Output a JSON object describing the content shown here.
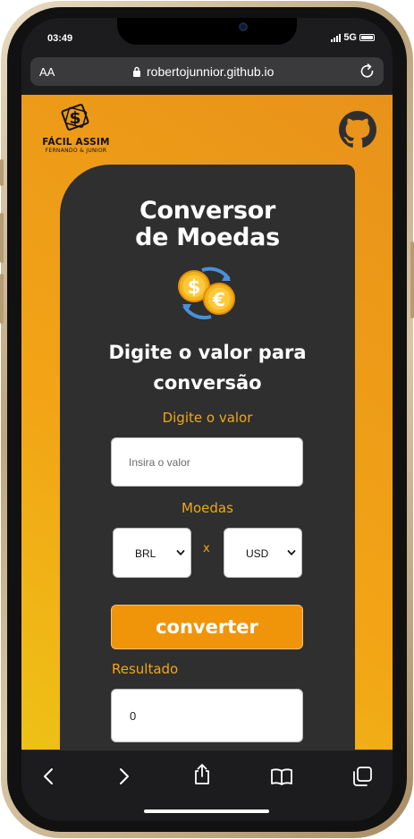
{
  "status_bar": {
    "time": "03:49",
    "network": "5G"
  },
  "browser": {
    "text_size": "AA",
    "url": "robertojunnior.github.io"
  },
  "site": {
    "logo": {
      "name": "FÁCIL ASSIM",
      "tagline": "FERNANDO & JUNIOR"
    },
    "title_line1": "Conversor",
    "title_line2": "de Moedas",
    "subtitle_line1": "Digite o valor para",
    "subtitle_line2": "conversão",
    "value_label": "Digite o valor",
    "value_placeholder": "Insira o valor",
    "currencies_label": "Moedas",
    "from_currency": "BRL",
    "separator": "x",
    "to_currency": "USD",
    "convert_label": "converter",
    "result_label": "Resultado",
    "result_value": "0"
  },
  "colors": {
    "accent": "#f0940a",
    "label": "#f0a818",
    "card": "#2f2f2f",
    "page_gradient": [
      "#eec116",
      "#f2a416",
      "#e8921a"
    ]
  },
  "icons": [
    "github-icon",
    "coins-exchange-icon",
    "lock-icon",
    "reload-icon",
    "back-icon",
    "forward-icon",
    "share-icon",
    "bookmarks-icon",
    "tabs-icon"
  ]
}
